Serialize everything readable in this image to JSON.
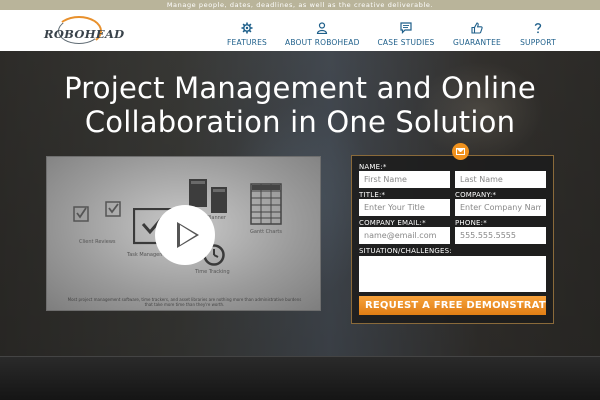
{
  "topbar": {
    "tagline": "Manage people, dates, deadlines, as well as the creative deliverable."
  },
  "logo": {
    "text": "ROBOHEAD"
  },
  "nav": {
    "items": [
      {
        "label": "FEATURES",
        "icon": "gear-icon"
      },
      {
        "label": "ABOUT ROBOHEAD",
        "icon": "person-icon"
      },
      {
        "label": "CASE STUDIES",
        "icon": "chat-icon"
      },
      {
        "label": "GUARANTEE",
        "icon": "thumbs-up-icon"
      },
      {
        "label": "SUPPORT",
        "icon": "question-icon"
      }
    ],
    "color": "#1e5f8a"
  },
  "hero": {
    "headline_line1": "Project Management and Online",
    "headline_line2": "Collaboration in One Solution"
  },
  "video": {
    "labels": {
      "client_reviews": "Client Reviews",
      "task_management": "Task Management",
      "planner": "Planner",
      "gantt_charts": "Gantt Charts",
      "time_tracking": "Time Tracking"
    },
    "caption": "Most project management software, time trackers, and asset libraries are nothing more than administrative burdens that take more time than they're worth."
  },
  "form": {
    "name_label": "NAME:*",
    "first_name_placeholder": "First Name",
    "last_name_placeholder": "Last Name",
    "title_label": "TITLE:*",
    "title_placeholder": "Enter Your Title",
    "company_label": "COMPANY:*",
    "company_placeholder": "Enter Company Name",
    "email_label": "COMPANY EMAIL:*",
    "email_placeholder": "name@email.com",
    "phone_label": "PHONE:*",
    "phone_placeholder": "555.555.5555",
    "situation_label": "SITUATION/CHALLENGES:",
    "submit_label": "REQUEST A FREE DEMONSTRATION",
    "accent": "#f0921e"
  }
}
